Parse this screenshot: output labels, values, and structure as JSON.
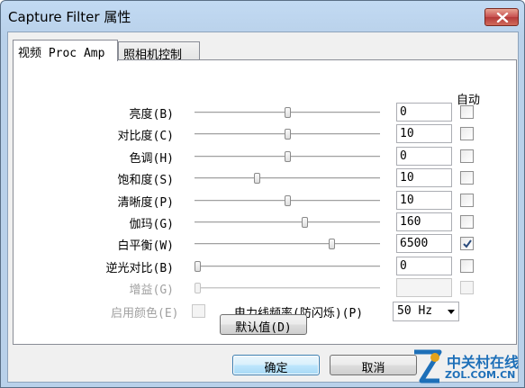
{
  "window": {
    "title": "Capture Filter 属性"
  },
  "tabs": [
    {
      "label": "视频 Proc Amp"
    },
    {
      "label": "照相机控制"
    }
  ],
  "auto_header": "自动",
  "properties": [
    {
      "label": "亮度(B)",
      "value": "0",
      "slider_fraction": 0.5,
      "auto": false,
      "enabled": true
    },
    {
      "label": "对比度(C)",
      "value": "10",
      "slider_fraction": 0.5,
      "auto": false,
      "enabled": true
    },
    {
      "label": "色调(H)",
      "value": "0",
      "slider_fraction": 0.5,
      "auto": false,
      "enabled": true
    },
    {
      "label": "饱和度(S)",
      "value": "10",
      "slider_fraction": 0.33,
      "auto": false,
      "enabled": true
    },
    {
      "label": "清晰度(P)",
      "value": "10",
      "slider_fraction": 0.5,
      "auto": false,
      "enabled": true
    },
    {
      "label": "伽玛(G)",
      "value": "160",
      "slider_fraction": 0.6,
      "auto": false,
      "enabled": true
    },
    {
      "label": "白平衡(W)",
      "value": "6500",
      "slider_fraction": 0.75,
      "auto": true,
      "enabled": true
    },
    {
      "label": "逆光对比(B)",
      "value": "0",
      "slider_fraction": 0.0,
      "auto": false,
      "enabled": true
    },
    {
      "label": "增益(G)",
      "value": "",
      "slider_fraction": 0.0,
      "auto": false,
      "enabled": false
    }
  ],
  "color_enable": {
    "label": "启用颜色(E)",
    "checked": false
  },
  "powerline": {
    "label": "电力线频率(防闪烁)(P)",
    "selected": "50 Hz"
  },
  "default_button": "默认值(D)",
  "ok_button": "确定",
  "cancel_button": "取消",
  "watermark": {
    "name": "中关村在线",
    "url": "ZOL.COM.CN"
  }
}
